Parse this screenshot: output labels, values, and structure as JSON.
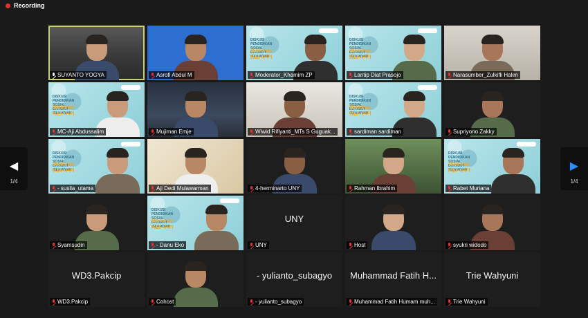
{
  "recording": {
    "label": "Recording",
    "dot_color": "#e0312e"
  },
  "pagination": {
    "left_label": "1/4",
    "right_label": "1/4",
    "left_arrow": "◀",
    "right_arrow": "▶"
  },
  "webinar": {
    "small": "DISKUSI PENDIDIKAN SOSIAL DAKWAH ISLAMIYAH",
    "big": "Webinar\nKEF-PPI"
  },
  "participants": [
    {
      "name": "SUYANTO YOGYA",
      "muted": false,
      "bg": "bg-room"
    },
    {
      "name": "Asrofi Abdul M",
      "muted": true,
      "bg": "bg-blue"
    },
    {
      "name": "Moderator_Khamim ZP",
      "muted": true,
      "bg": "bg-webinar"
    },
    {
      "name": "Lantip Diat Prasojo",
      "muted": true,
      "bg": "bg-webinar"
    },
    {
      "name": "Narasumber_Zulkifli Halim",
      "muted": true,
      "bg": "bg-wall"
    },
    {
      "name": "MC-Aji Abdussalim",
      "muted": true,
      "bg": "bg-webinar"
    },
    {
      "name": "Mujiman Emje",
      "muted": true,
      "bg": "bg-night"
    },
    {
      "name": "Wiwid Rifiyanti_MTs S Guguak...",
      "muted": true,
      "bg": "bg-office"
    },
    {
      "name": "sardiman sardiman",
      "muted": true,
      "bg": "bg-webinar"
    },
    {
      "name": "Supriyono Zakky",
      "muted": true,
      "bg": "bg-dark"
    },
    {
      "name": "- susila_utama",
      "muted": true,
      "bg": "bg-webinar"
    },
    {
      "name": "Aji Dedi Mulawarman",
      "muted": true,
      "bg": "bg-key"
    },
    {
      "name": "4-herminarto UNY",
      "muted": true,
      "bg": "bg-dark"
    },
    {
      "name": "Rahman Ibrahim",
      "muted": true,
      "bg": "bg-green"
    },
    {
      "name": "Rabet Muriana",
      "muted": true,
      "bg": "bg-webinar"
    },
    {
      "name": "Syamsudin",
      "muted": true,
      "bg": "bg-dark"
    },
    {
      "name": "- Danu Eko",
      "muted": true,
      "bg": "bg-webinar"
    },
    {
      "name": "UNY",
      "muted": true,
      "bg": "bg-dark",
      "center_text": "UNY"
    },
    {
      "name": "Host",
      "muted": true,
      "bg": "bg-dark"
    },
    {
      "name": "syukri widodo",
      "muted": true,
      "bg": "bg-dark"
    },
    {
      "name": "WD3.Pakcip",
      "muted": true,
      "bg": "bg-dark",
      "center_text": "WD3.Pakcip"
    },
    {
      "name": "Cohost",
      "muted": true,
      "bg": "bg-dark"
    },
    {
      "name": "- yulianto_subagyo",
      "muted": true,
      "bg": "bg-dark",
      "center_text": "- yulianto_subagyo"
    },
    {
      "name": "Muhammad Fatih Humam muh...",
      "muted": true,
      "bg": "bg-dark",
      "center_text": "Muhammad Fatih H..."
    },
    {
      "name": "Trie Wahyuni",
      "muted": true,
      "bg": "bg-dark",
      "center_text": "Trie Wahyuni"
    }
  ]
}
